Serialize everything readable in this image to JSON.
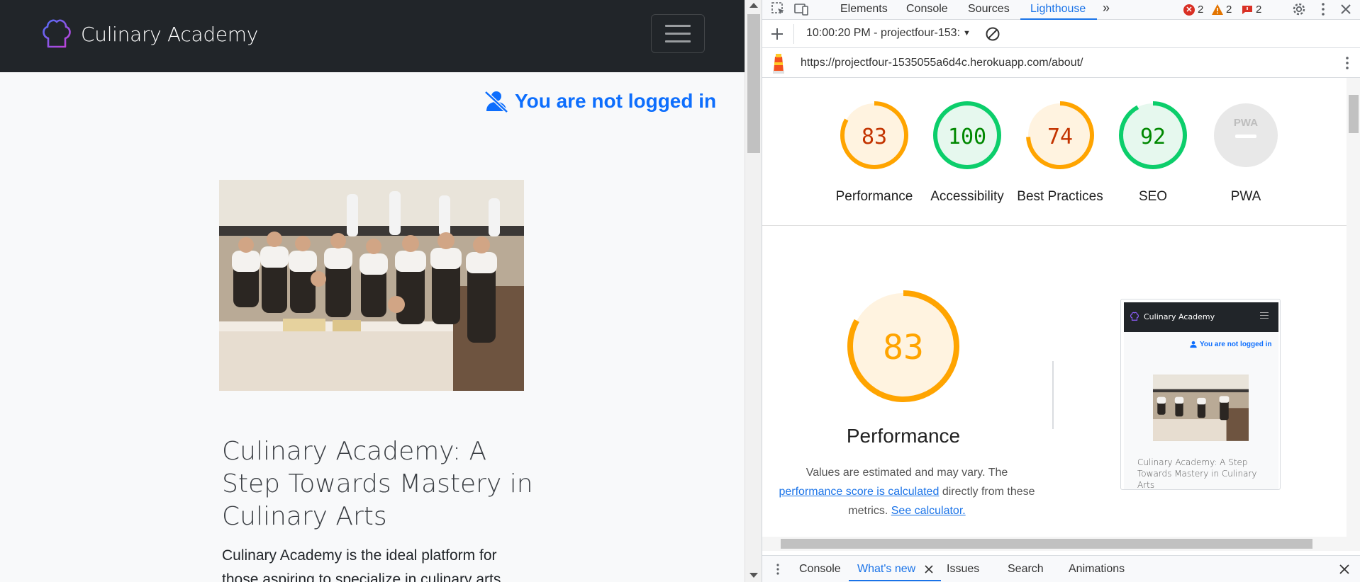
{
  "site": {
    "brand": "Culinary Academy",
    "login_status": "You are not logged in",
    "about_title": "Culinary Academy: A Step Towards Mastery in Culinary Arts",
    "about_text": "Culinary Academy is the ideal platform for those aspiring to specialize in culinary arts."
  },
  "devtools": {
    "tabs": [
      "Elements",
      "Console",
      "Sources",
      "Lighthouse"
    ],
    "active_tab": "Lighthouse",
    "errors": "2",
    "warnings": "2",
    "issues": "2",
    "report_selector": "10:00:20 PM - projectfour-153:",
    "report_url": "https://projectfour-1535055a6d4c.herokuapp.com/about/",
    "scores": [
      {
        "label": "Performance",
        "score": 83,
        "color": "#ffa400"
      },
      {
        "label": "Accessibility",
        "score": 100,
        "color": "#0cce6b"
      },
      {
        "label": "Best Practices",
        "score": 74,
        "color": "#ffa400"
      },
      {
        "label": "SEO",
        "score": 92,
        "color": "#0cce6b"
      },
      {
        "label": "PWA",
        "score": null,
        "color": "#cccccc"
      }
    ],
    "pwa_badge": "PWA",
    "performance": {
      "score": "83",
      "title": "Performance",
      "desc_1": "Values are estimated and may vary. The",
      "link_1": "performance score is calculated",
      "desc_2": "directly from these metrics.",
      "link_2": "See calculator."
    },
    "thumbnail": {
      "brand": "Culinary Academy",
      "login": "You are not logged in",
      "title": "Culinary Academy: A Step Towards Mastery in Culinary Arts"
    },
    "drawer_tabs": [
      "Console",
      "What's new",
      "Issues",
      "Search",
      "Animations"
    ],
    "drawer_active": "What's new"
  },
  "colors": {
    "navbar": "#212529",
    "link_blue": "#0d6efd",
    "devtools_blue": "#1a73e8",
    "average": "#ffa400",
    "pass": "#0cce6b"
  }
}
